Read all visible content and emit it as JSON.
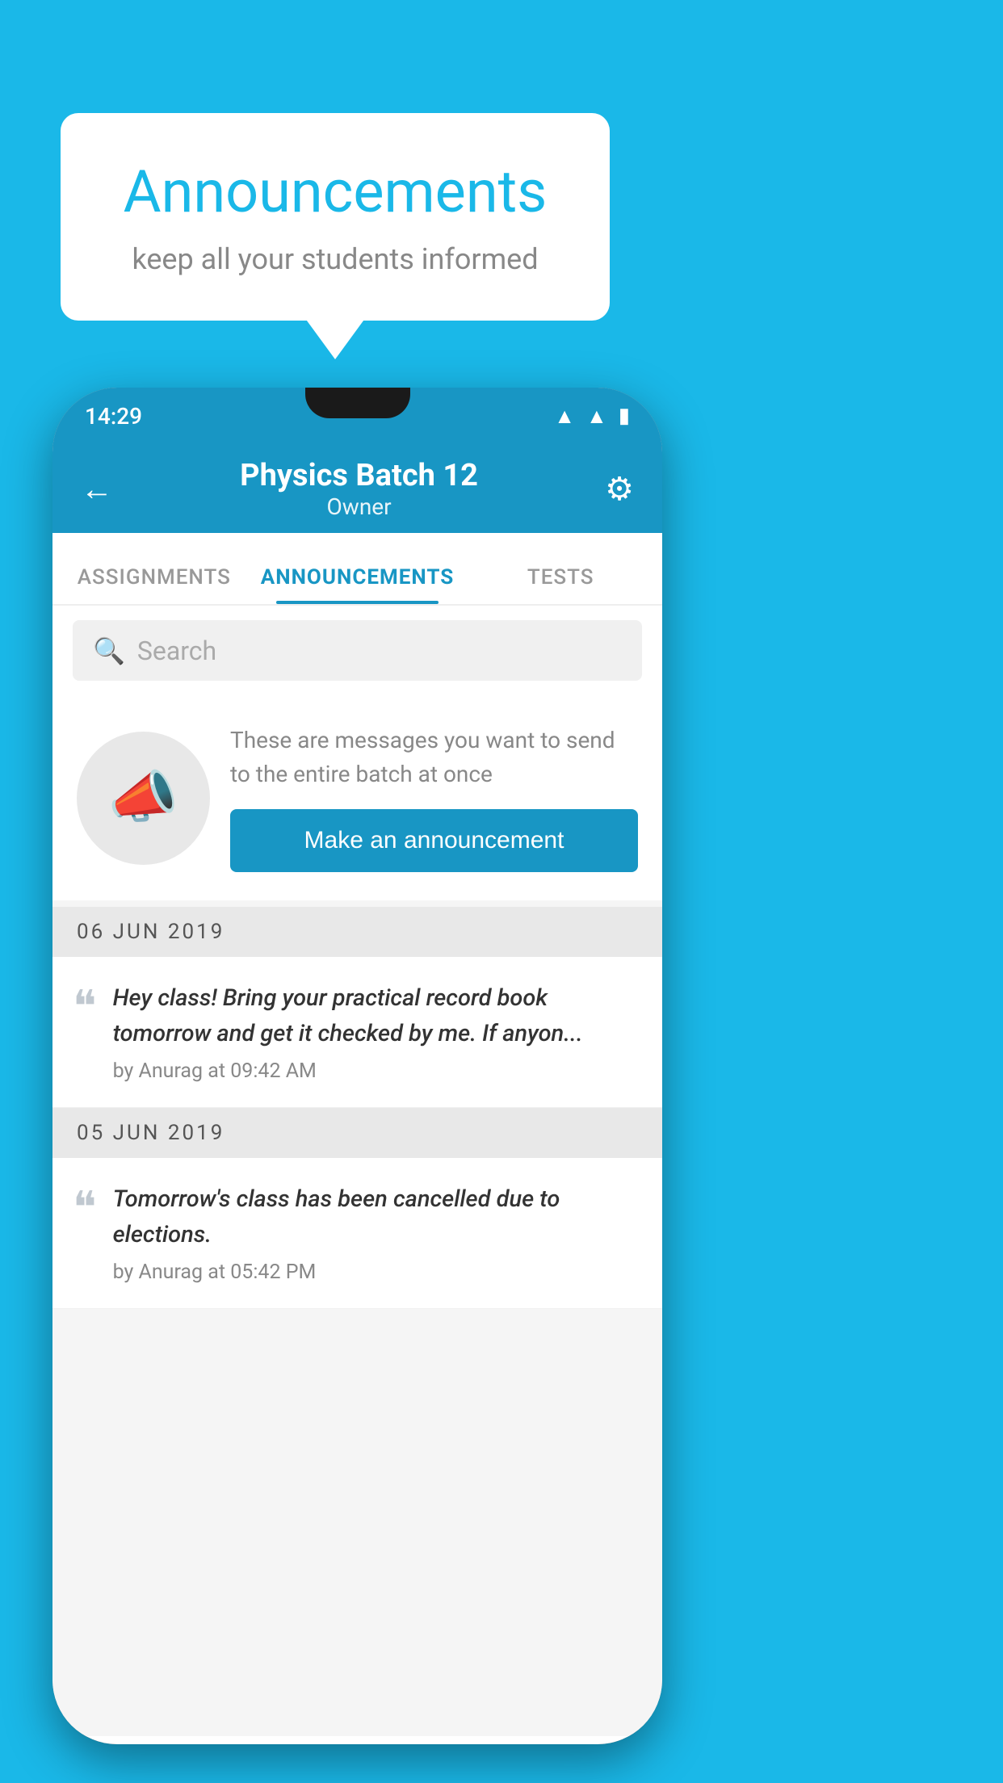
{
  "background_color": "#1ab8e8",
  "speech_bubble": {
    "title": "Announcements",
    "subtitle": "keep all your students informed"
  },
  "phone": {
    "status_bar": {
      "time": "14:29",
      "icons": [
        "wifi",
        "signal",
        "battery"
      ]
    },
    "app_bar": {
      "title": "Physics Batch 12",
      "subtitle": "Owner",
      "back_label": "←",
      "gear_label": "⚙"
    },
    "tabs": [
      {
        "label": "ASSIGNMENTS",
        "active": false
      },
      {
        "label": "ANNOUNCEMENTS",
        "active": true
      },
      {
        "label": "TESTS",
        "active": false
      }
    ],
    "search": {
      "placeholder": "Search"
    },
    "promo": {
      "description": "These are messages you want to send to the entire batch at once",
      "button_label": "Make an announcement"
    },
    "announcements": [
      {
        "date": "06  JUN  2019",
        "text": "Hey class! Bring your practical record book tomorrow and get it checked by me. If anyon...",
        "meta": "by Anurag at 09:42 AM"
      },
      {
        "date": "05  JUN  2019",
        "text": "Tomorrow's class has been cancelled due to elections.",
        "meta": "by Anurag at 05:42 PM"
      }
    ]
  }
}
